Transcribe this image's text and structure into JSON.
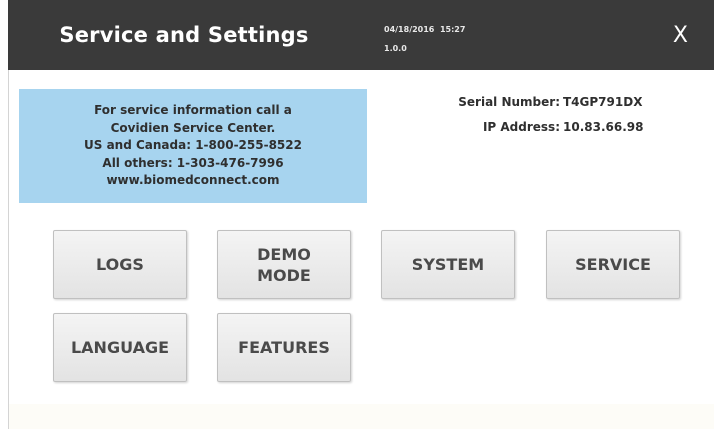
{
  "header": {
    "title": "Service and Settings",
    "date_time": "04/18/2016  15:27",
    "version": "1.0.0",
    "close_label": "X"
  },
  "service_info": {
    "lines": [
      "For service information call a",
      "Covidien Service Center.",
      "US and Canada: 1-800-255-8522",
      "All others: 1-303-476-7996",
      "www.biomedconnect.com"
    ]
  },
  "device": {
    "serial_label": "Serial Number:",
    "serial_value": "T4GP791DX",
    "ip_label": "IP Address:",
    "ip_value": "10.83.66.98"
  },
  "buttons": {
    "logs": "LOGS",
    "demo_mode": "DEMO\nMODE",
    "system": "SYSTEM",
    "service": "SERVICE",
    "language": "LANGUAGE",
    "features": "FEATURES"
  },
  "colors": {
    "header_bg": "#3a3a3a",
    "info_bg": "#a7d4ef",
    "button_bg": "#e8e8e8"
  }
}
